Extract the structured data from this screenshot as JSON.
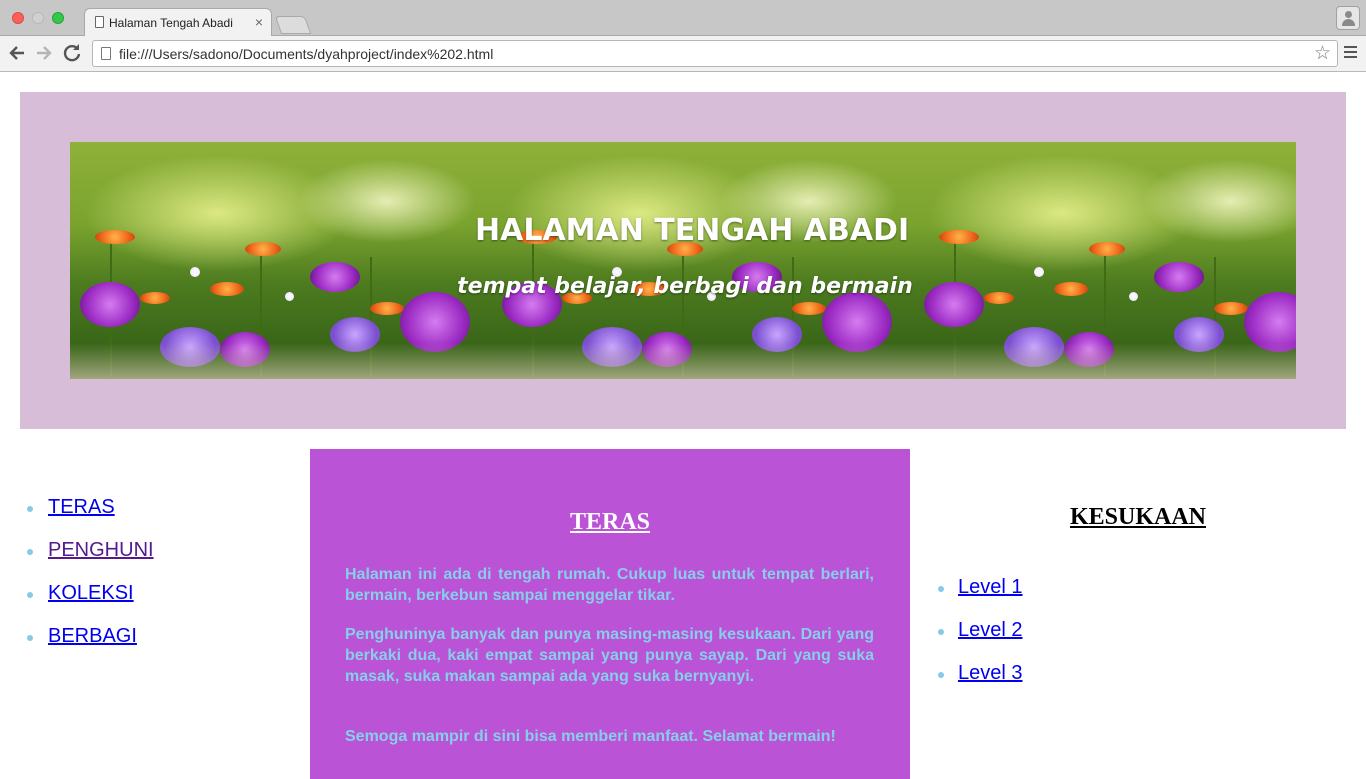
{
  "browser": {
    "tab_title": "Halaman Tengah Abadi",
    "tab_close": "×",
    "url": "file:///Users/sadono/Documents/dyahproject/index%202.html"
  },
  "header": {
    "title": "HALAMAN TENGAH ABADI",
    "subtitle": "tempat belajar, berbagi dan bermain"
  },
  "nav": {
    "items": [
      {
        "label": "TERAS"
      },
      {
        "label": "PENGHUNI"
      },
      {
        "label": "KOLEKSI"
      },
      {
        "label": "BERBAGI"
      }
    ]
  },
  "main": {
    "heading": "TERAS",
    "paragraphs": [
      "Halaman ini ada di tengah rumah. Cukup luas untuk tempat berlari, bermain, berkebun sampai menggelar tikar.",
      "Penghuninya banyak dan punya masing-masing kesukaan. Dari yang berkaki dua, kaki empat sampai yang punya sayap. Dari yang suka masak, suka makan sampai ada yang suka bernyanyi.",
      "Semoga mampir di sini bisa memberi manfaat. Selamat bermain!"
    ]
  },
  "sidebar": {
    "heading": "KESUKAAN",
    "items": [
      {
        "label": "Level 1"
      },
      {
        "label": "Level 2"
      },
      {
        "label": "Level 3"
      }
    ]
  },
  "colors": {
    "header_bg": "#d8bdd9",
    "content_bg": "#bb53d6",
    "content_text": "#87ceeb",
    "bullet": "#88c9e5",
    "link": "#0000ee",
    "visited_link": "#551a8b"
  }
}
